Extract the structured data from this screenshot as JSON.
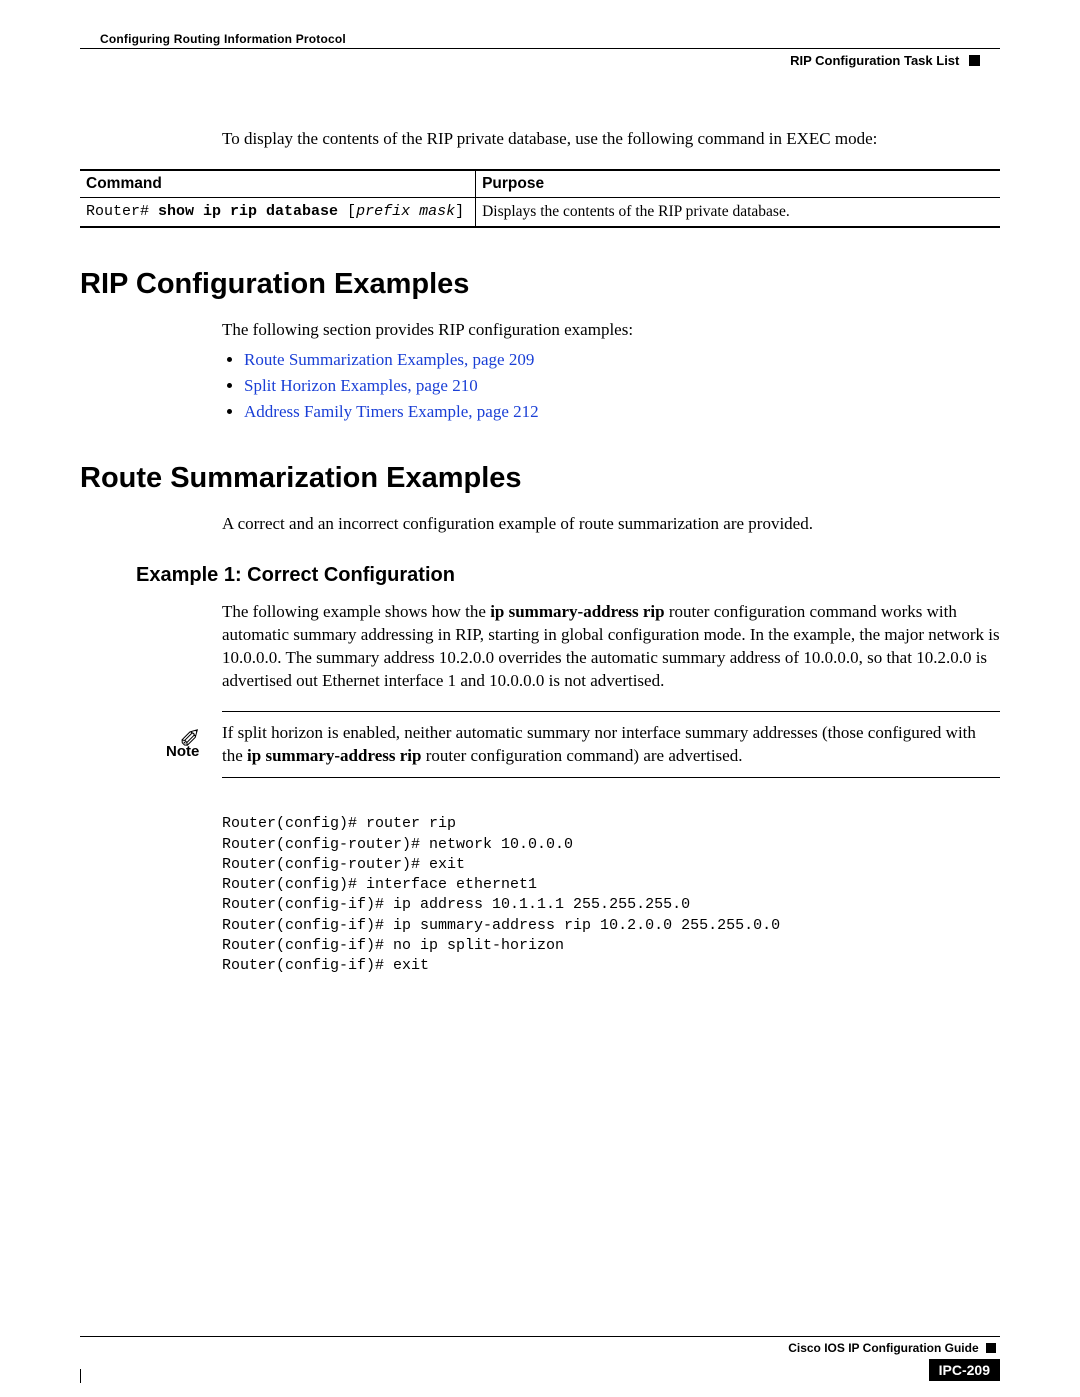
{
  "header": {
    "chapter": "Configuring Routing Information Protocol",
    "section_running": "RIP Configuration Task List"
  },
  "intro_para": "To display the contents of the RIP private database, use the following command in EXEC mode:",
  "table": {
    "head_command": "Command",
    "head_purpose": "Purpose",
    "row": {
      "cmd_prefix": "Router# ",
      "cmd_bold": "show ip rip database",
      "cmd_suffix_open": " [",
      "cmd_italic": "prefix mask",
      "cmd_suffix_close": "]",
      "purpose": "Displays the contents of the RIP private database."
    }
  },
  "h1_examples": "RIP Configuration Examples",
  "examples_intro": "The following section provides RIP configuration examples:",
  "links": [
    "Route Summarization Examples, page 209",
    "Split Horizon Examples, page 210",
    "Address Family Timers Example, page 212"
  ],
  "h1_route_sum": "Route Summarization Examples",
  "route_sum_intro": "A correct and an incorrect configuration example of route summarization are provided.",
  "h2_example1": "Example 1: Correct Configuration",
  "ex1_para_pre": "The following example shows how the ",
  "ex1_cmd_bold": "ip summary-address rip",
  "ex1_para_post": " router configuration command works with automatic summary addressing in RIP, starting in global configuration mode. In the example, the major network is 10.0.0.0. The summary address 10.2.0.0 overrides the automatic summary address of 10.0.0.0, so that 10.2.0.0 is advertised out Ethernet interface 1 and 10.0.0.0 is not advertised.",
  "note": {
    "label": "Note",
    "pre": "If split horizon is enabled, neither automatic summary nor interface summary addresses (those configured with the ",
    "bold": "ip summary-address rip",
    "post": " router configuration command) are advertised."
  },
  "cli": "Router(config)# router rip\nRouter(config-router)# network 10.0.0.0\nRouter(config-router)# exit\nRouter(config)# interface ethernet1\nRouter(config-if)# ip address 10.1.1.1 255.255.255.0\nRouter(config-if)# ip summary-address rip 10.2.0.0 255.255.0.0\nRouter(config-if)# no ip split-horizon\nRouter(config-if)# exit",
  "footer": {
    "guide": "Cisco IOS IP Configuration Guide",
    "page_num": "IPC-209"
  }
}
